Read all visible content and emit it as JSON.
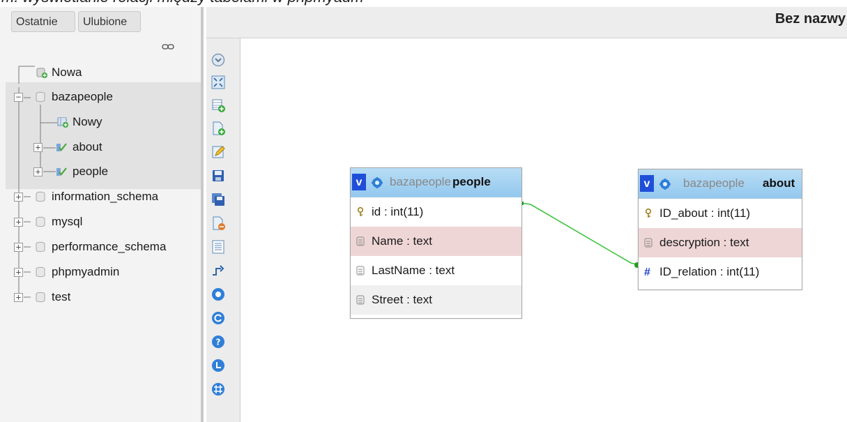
{
  "navigation": {
    "tabs": [
      "Ostatnie",
      "Ulubione"
    ],
    "link_icon": "chain-link-icon",
    "tree": {
      "new_server_item": "Nowa",
      "databases": [
        {
          "name": "bazapeople",
          "expanded": true,
          "children": {
            "new_table": "Nowy",
            "tables": [
              "about",
              "people"
            ]
          }
        },
        {
          "name": "information_schema",
          "expanded": false
        },
        {
          "name": "mysql",
          "expanded": false
        },
        {
          "name": "performance_schema",
          "expanded": false
        },
        {
          "name": "phpmyadmin",
          "expanded": false
        },
        {
          "name": "test",
          "expanded": false
        }
      ]
    }
  },
  "header": {
    "title": "Bez nazwy"
  },
  "toolbar": {
    "icons": [
      "toggle-icon",
      "fullscreen-icon",
      "add-table-icon",
      "new-page-icon",
      "edit-page-icon",
      "save-icon",
      "save-as-icon",
      "delete-page-icon",
      "export-icon",
      "relation-icon",
      "circle-icon",
      "reload-icon",
      "help-icon",
      "angular-links-icon",
      "grid-icon"
    ]
  },
  "designer": {
    "tables": [
      {
        "db": "bazapeople",
        "name": "people",
        "toggle": "v",
        "columns": [
          {
            "label": "id : int(11)",
            "kind": "key",
            "style": "normal"
          },
          {
            "label": "Name : text",
            "kind": "text",
            "style": "highlight"
          },
          {
            "label": "LastName : text",
            "kind": "text",
            "style": "normal"
          },
          {
            "label": "Street : text",
            "kind": "text",
            "style": "gray"
          }
        ]
      },
      {
        "db": "bazapeople",
        "name": "about",
        "toggle": "v",
        "columns": [
          {
            "label": "ID_about : int(11)",
            "kind": "key",
            "style": "normal"
          },
          {
            "label": "descryption : text",
            "kind": "text",
            "style": "highlight"
          },
          {
            "label": "ID_relation : int(11)",
            "kind": "number",
            "style": "normal"
          }
        ]
      }
    ],
    "colors": {
      "relation_line": "#3cc33c",
      "header_blue": "#93c8ee",
      "row_highlight": "#efd6d6"
    }
  }
}
